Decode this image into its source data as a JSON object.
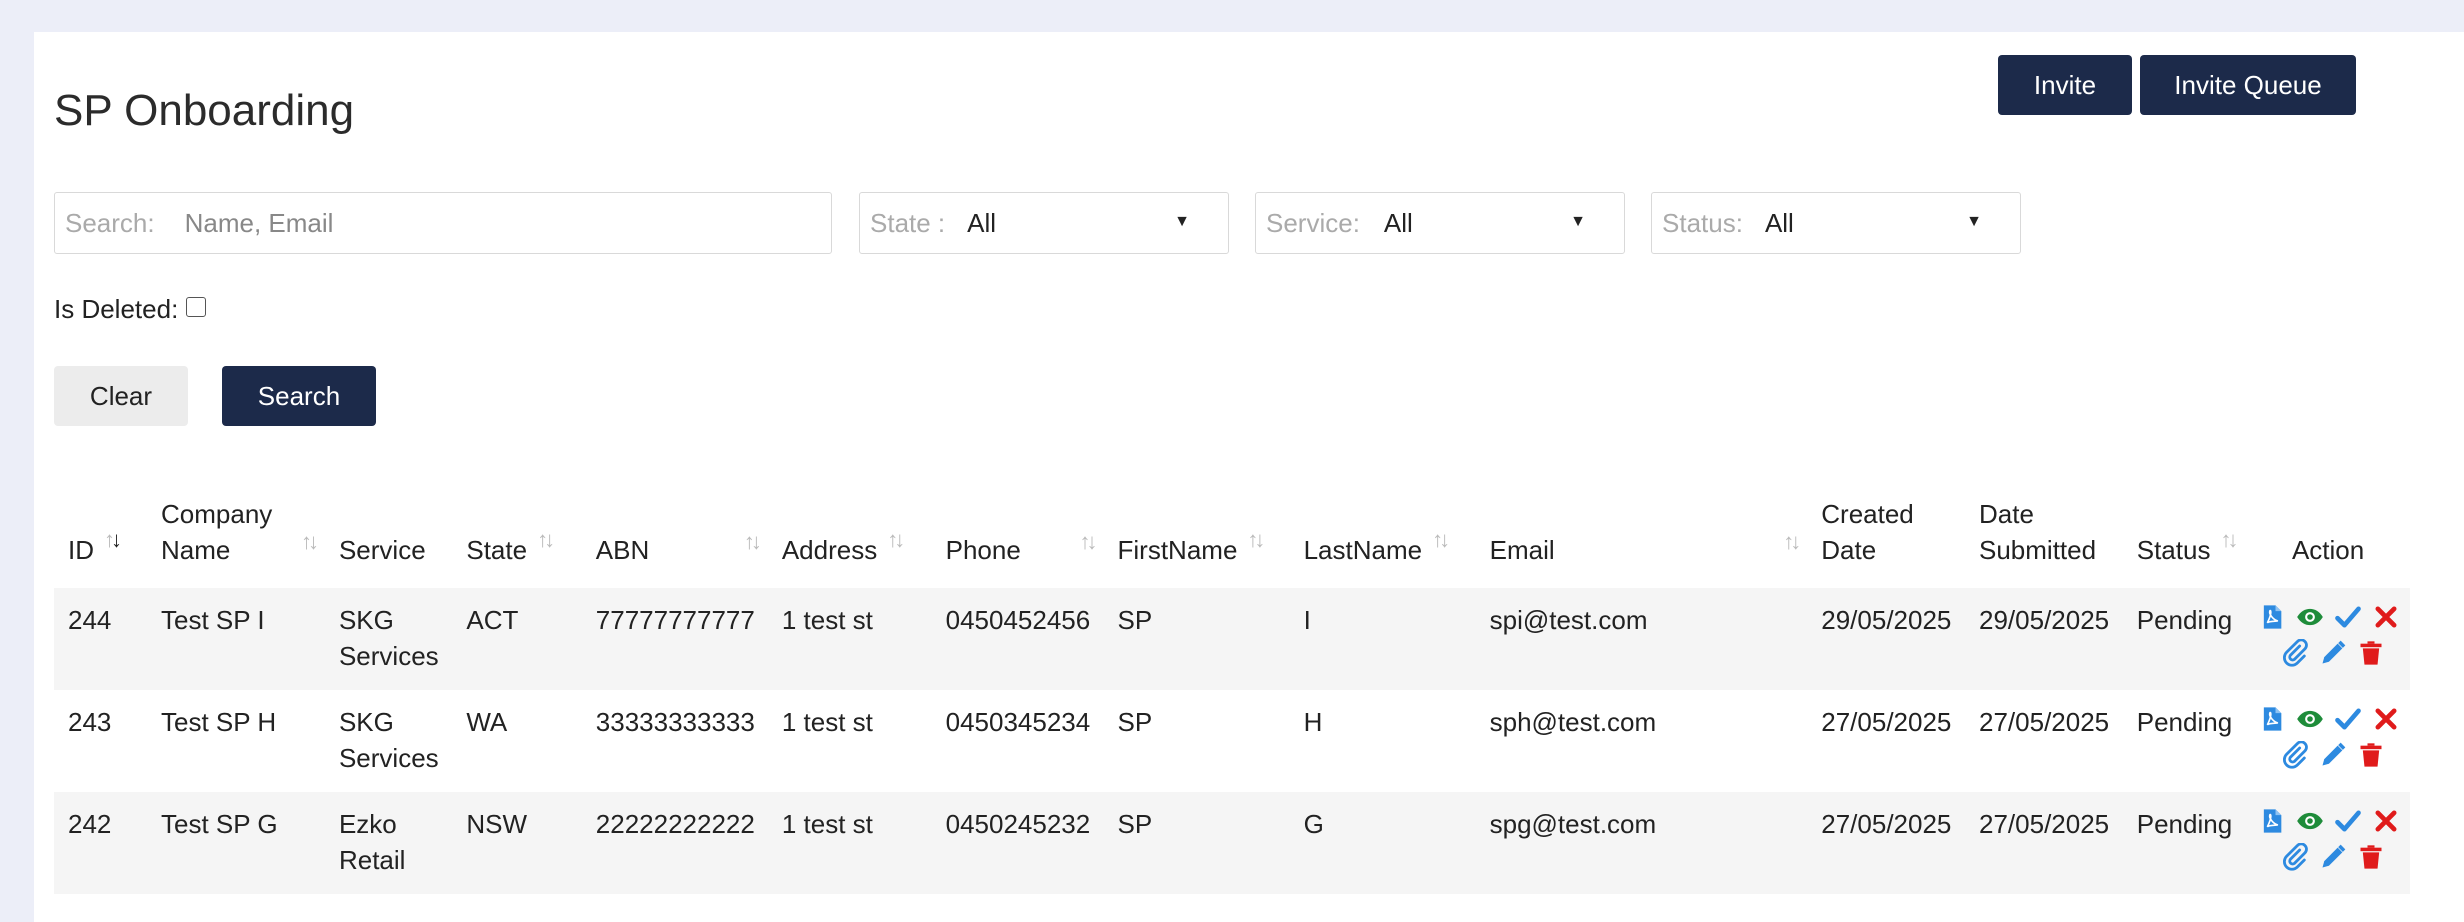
{
  "page": {
    "title": "SP Onboarding"
  },
  "toolbar": {
    "invite_label": "Invite",
    "invite_queue_label": "Invite Queue"
  },
  "filters": {
    "search_label": "Search:",
    "search_placeholder": "Name, Email",
    "state_label": "State :",
    "state_value": "All",
    "service_label": "Service:",
    "service_value": "All",
    "status_label": "Status:",
    "status_value": "All",
    "is_deleted_label": "Is Deleted:",
    "clear_label": "Clear",
    "search_button_label": "Search"
  },
  "table": {
    "columns": {
      "id": "ID",
      "company_name": "Company Name",
      "service": "Service",
      "state": "State",
      "abn": "ABN",
      "address": "Address",
      "phone": "Phone",
      "firstname": "FirstName",
      "lastname": "LastName",
      "email": "Email",
      "created_date": "Created Date",
      "date_submitted": "Date Submitted",
      "status": "Status",
      "action": "Action"
    },
    "rows": [
      {
        "id": "244",
        "company_name": "Test SP I",
        "service": "SKG Services",
        "state": "ACT",
        "abn": "77777777777",
        "address": "1 test st",
        "phone": "0450452456",
        "firstname": "SP",
        "lastname": "I",
        "email": "spi@test.com",
        "created_date": "29/05/2025",
        "date_submitted": "29/05/2025",
        "status": "Pending"
      },
      {
        "id": "243",
        "company_name": "Test SP H",
        "service": "SKG Services",
        "state": "WA",
        "abn": "33333333333",
        "address": "1 test st",
        "phone": "0450345234",
        "firstname": "SP",
        "lastname": "H",
        "email": "sph@test.com",
        "created_date": "27/05/2025",
        "date_submitted": "27/05/2025",
        "status": "Pending"
      },
      {
        "id": "242",
        "company_name": "Test SP G",
        "service": "Ezko Retail",
        "state": "NSW",
        "abn": "22222222222",
        "address": "1 test st",
        "phone": "0450245232",
        "firstname": "SP",
        "lastname": "G",
        "email": "spg@test.com",
        "created_date": "27/05/2025",
        "date_submitted": "27/05/2025",
        "status": "Pending"
      }
    ],
    "action_icons": [
      "pdf-icon",
      "view-icon",
      "approve-icon",
      "reject-icon",
      "attachment-icon",
      "edit-icon",
      "delete-icon"
    ]
  },
  "colors": {
    "primary_button": "#1c2a4a",
    "background": "#eceef8",
    "icon_blue": "#2d8ae0",
    "icon_green": "#1e8c3a",
    "icon_red": "#e01b1b"
  }
}
